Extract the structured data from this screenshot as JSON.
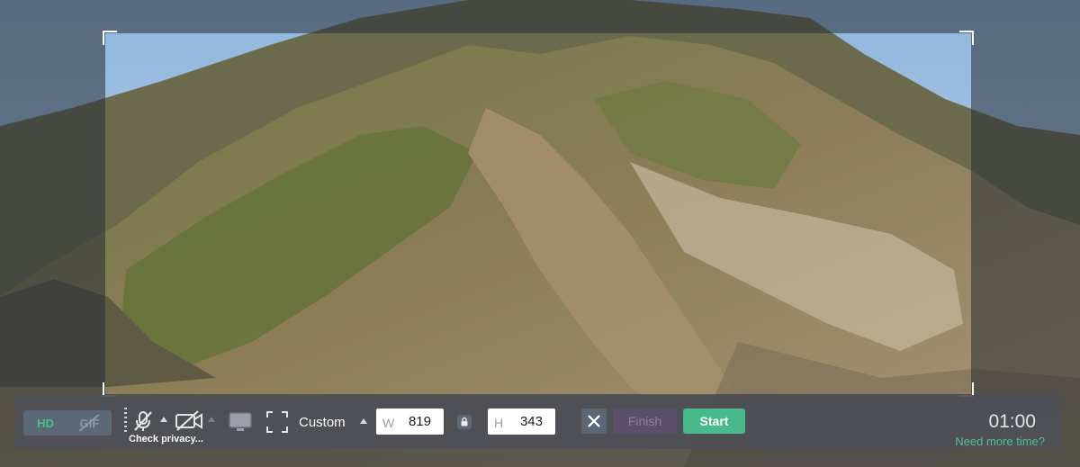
{
  "toolbar": {
    "quality": {
      "hd_label": "HD",
      "gif_label": "GIF",
      "selected": "HD"
    },
    "audio": {
      "icon": "microphone-muted-icon",
      "state": "off"
    },
    "camera": {
      "icon": "camera-muted-icon",
      "state": "off"
    },
    "screen_icon": "monitor-icon",
    "fullscreen_icon": "fullscreen-icon",
    "privacy_label": "Check privacy...",
    "preset_label": "Custom",
    "width_prefix": "W",
    "width_value": "819",
    "height_prefix": "H",
    "height_value": "343",
    "lock_icon": "lock-icon",
    "cancel_icon": "close-icon",
    "finish_label": "Finish",
    "start_label": "Start",
    "timer": "01:00",
    "more_time_label": "Need more time?"
  },
  "colors": {
    "accent_green": "#47b98a",
    "toolbar_bg": "#4e5056",
    "finish_bg": "#5c4f6a"
  }
}
